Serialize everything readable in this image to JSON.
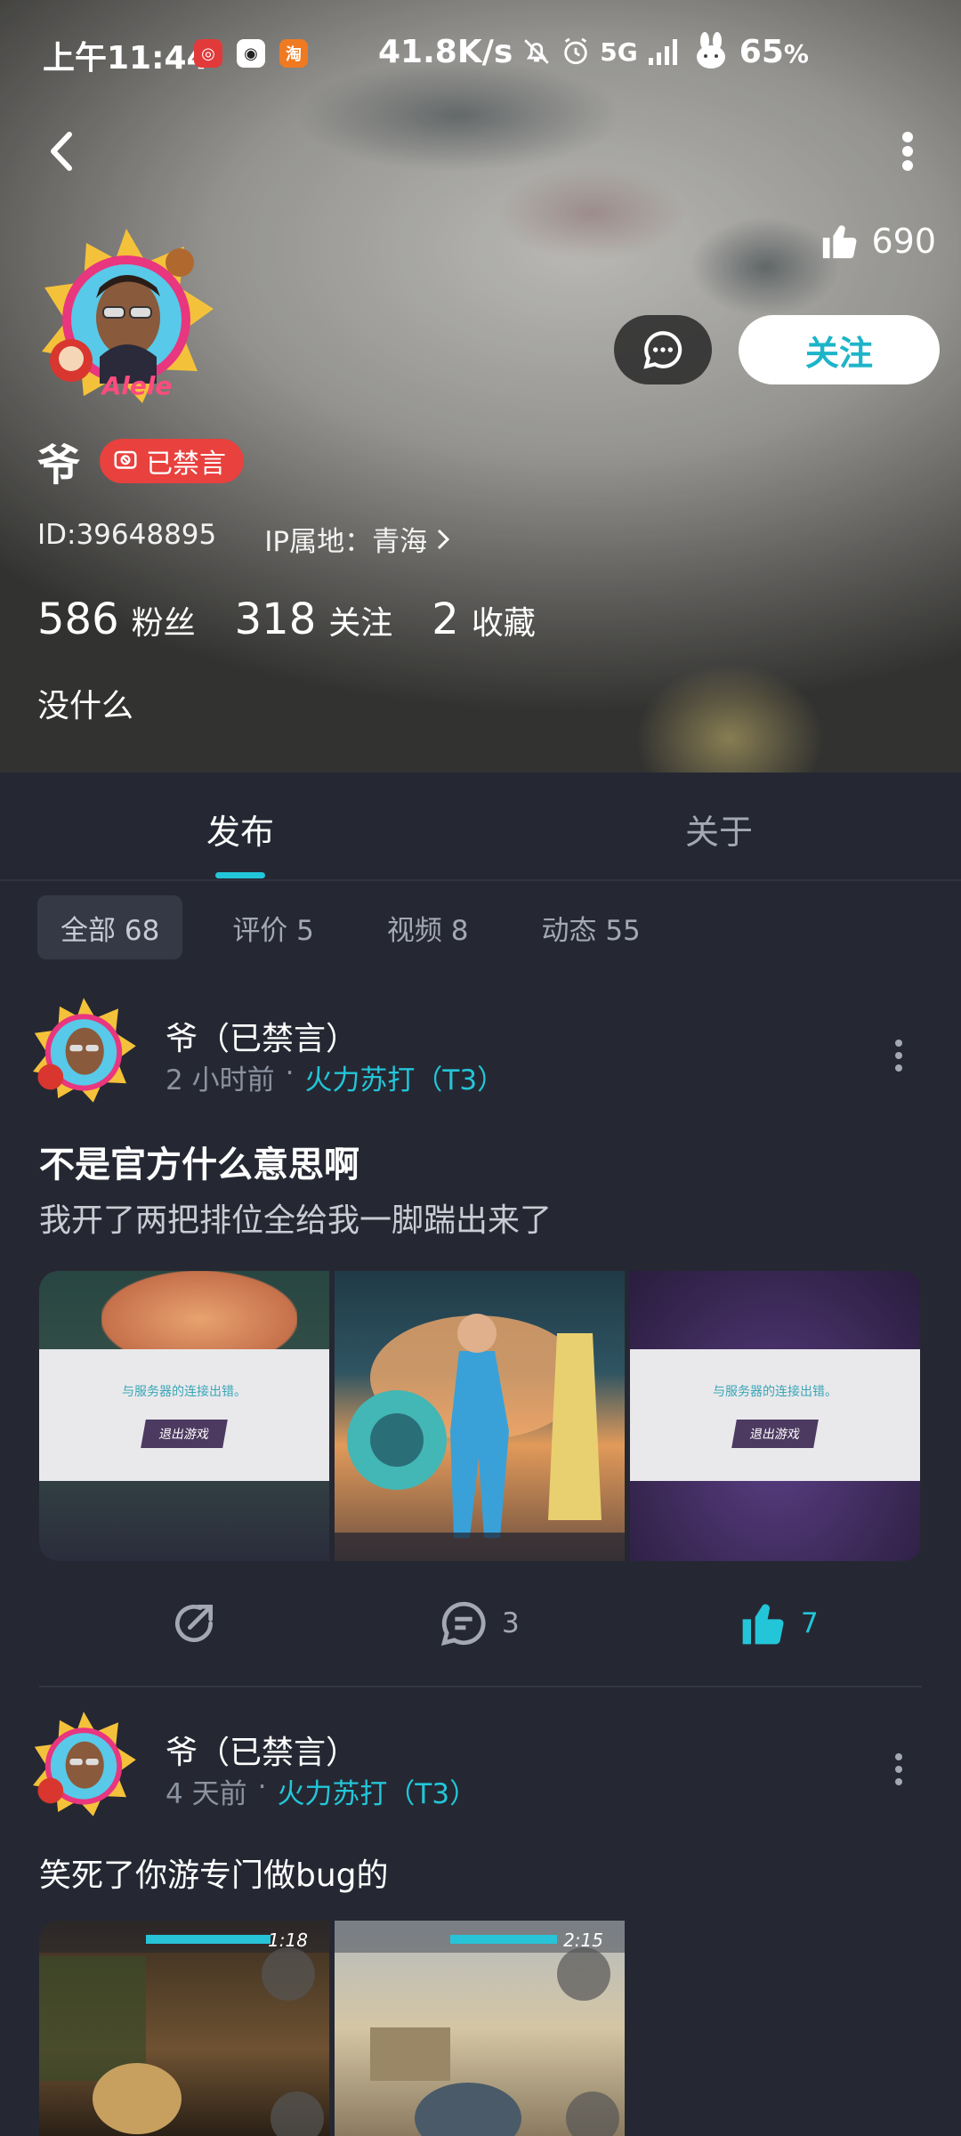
{
  "status_bar": {
    "time": "上午11:44",
    "app_icons": [
      "netease-icon",
      "qq-icon",
      "taobao-icon"
    ],
    "taobao_glyph": "淘",
    "network_speed": "41.8K/s",
    "network_type": "5G",
    "battery": "65",
    "battery_unit": "%"
  },
  "profile": {
    "likes": "690",
    "follow_label": "关注",
    "username": "爷",
    "ban_badge": "已禁言",
    "id_text": "ID:39648895",
    "ip_text": "IP属地：青海",
    "followers_count": "586",
    "followers_label": "粉丝",
    "following_count": "318",
    "following_label": "关注",
    "favorites_count": "2",
    "favorites_label": "收藏",
    "bio": "没什么"
  },
  "tabs": {
    "active": "发布",
    "inactive": "关于"
  },
  "filters": [
    {
      "label": "全部 68",
      "active": true
    },
    {
      "label": "评价 5",
      "active": false
    },
    {
      "label": "视频 8",
      "active": false
    },
    {
      "label": "动态 55",
      "active": false
    }
  ],
  "posts": [
    {
      "author": "爷（已禁言）",
      "time": "2 小时前",
      "separator": "·",
      "game": "火力苏打（T3）",
      "title": "不是官方什么意思啊",
      "body": "我开了两把排位全给我一脚踹出来了",
      "images": [
        {
          "kind": "error-screen",
          "message": "与服务器的连接出错。",
          "button": "退出游戏"
        },
        {
          "kind": "game-lobby"
        },
        {
          "kind": "error-screen-purple",
          "message": "与服务器的连接出错。",
          "button": "退出游戏"
        }
      ],
      "comments": "3",
      "likes": "7",
      "liked": true
    },
    {
      "author": "爷（已禁言）",
      "time": "4 天前",
      "separator": "·",
      "game": "火力苏打（T3）",
      "title": "",
      "body": "笑死了你游专门做bug的",
      "images": [
        {
          "kind": "gameplay",
          "timer": "1:18"
        },
        {
          "kind": "gameplay",
          "timer": "2:15"
        }
      ]
    }
  ],
  "colors": {
    "accent": "#23c6d8",
    "ban_red": "#e8413e",
    "background": "#252833"
  }
}
